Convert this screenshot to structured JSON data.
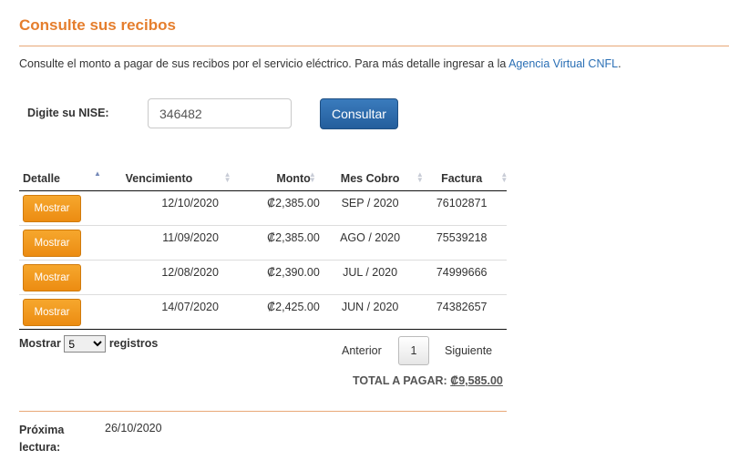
{
  "header": {
    "title": "Consulte sus recibos",
    "description": "Consulte el monto a pagar de sus recibos por el servicio eléctrico. Para más detalle ingresar a la ",
    "link_text": "Agencia Virtual CNFL",
    "description_end": "."
  },
  "form": {
    "nise_label": "Digite su NISE:",
    "nise_value": "346482",
    "submit_label": "Consultar"
  },
  "table": {
    "columns": [
      "Detalle",
      "Vencimiento",
      "Monto",
      "Mes Cobro",
      "Factura"
    ],
    "sorted_column": "Detalle",
    "rows": [
      {
        "button": "Mostrar",
        "vencimiento": "12/10/2020",
        "monto": "₡2,385.00",
        "mes": "SEP / 2020",
        "factura": "76102871"
      },
      {
        "button": "Mostrar",
        "vencimiento": "11/09/2020",
        "monto": "₡2,385.00",
        "mes": "AGO / 2020",
        "factura": "75539218"
      },
      {
        "button": "Mostrar",
        "vencimiento": "12/08/2020",
        "monto": "₡2,390.00",
        "mes": "JUL / 2020",
        "factura": "74999666"
      },
      {
        "button": "Mostrar",
        "vencimiento": "14/07/2020",
        "monto": "₡2,425.00",
        "mes": "JUN / 2020",
        "factura": "74382657"
      }
    ]
  },
  "length": {
    "prefix": "Mostrar",
    "selected": "5",
    "suffix": "registros"
  },
  "pager": {
    "prev": "Anterior",
    "current": "1",
    "next": "Siguiente"
  },
  "total": {
    "label": "TOTAL A PAGAR:",
    "amount": "₡9,585.00"
  },
  "next_reading": {
    "label": "Próxima lectura:",
    "value": "26/10/2020"
  },
  "colors": {
    "accent": "#e57e2d",
    "primary_button": "#2d6aa8",
    "detail_button": "#f09a1e",
    "link": "#2a6fb5"
  }
}
